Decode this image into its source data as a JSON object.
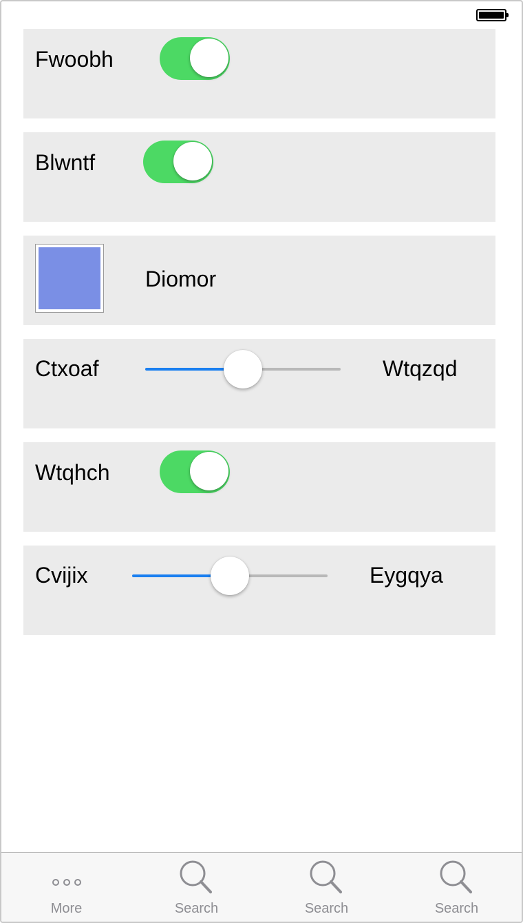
{
  "status_bar": {
    "battery_icon": "battery-full-icon"
  },
  "rows": {
    "r1": {
      "label": "Fwoobh",
      "switch_on": true
    },
    "r2": {
      "label": "Blwntf",
      "switch_on": true
    },
    "r3": {
      "label": "Diomor",
      "swatch_color": "#7a8fe5"
    },
    "r4": {
      "min_label": "Ctxoaf",
      "max_label": "Wtqzqd",
      "value": 0.5
    },
    "r5": {
      "label": "Wtqhch",
      "switch_on": true
    },
    "r6": {
      "min_label": "Cvijix",
      "max_label": "Eygqya",
      "value": 0.5
    }
  },
  "tabbar": {
    "tabs": [
      {
        "label": "More",
        "icon": "more-dots-icon"
      },
      {
        "label": "Search",
        "icon": "search-icon"
      },
      {
        "label": "Search",
        "icon": "search-icon"
      },
      {
        "label": "Search",
        "icon": "search-icon"
      }
    ]
  },
  "colors": {
    "switch_on": "#4cd964",
    "slider_min_track": "#1a7ff0",
    "slider_max_track": "#b8b8b8",
    "row_background": "#ebebeb",
    "tab_inactive": "#8e8e93"
  }
}
